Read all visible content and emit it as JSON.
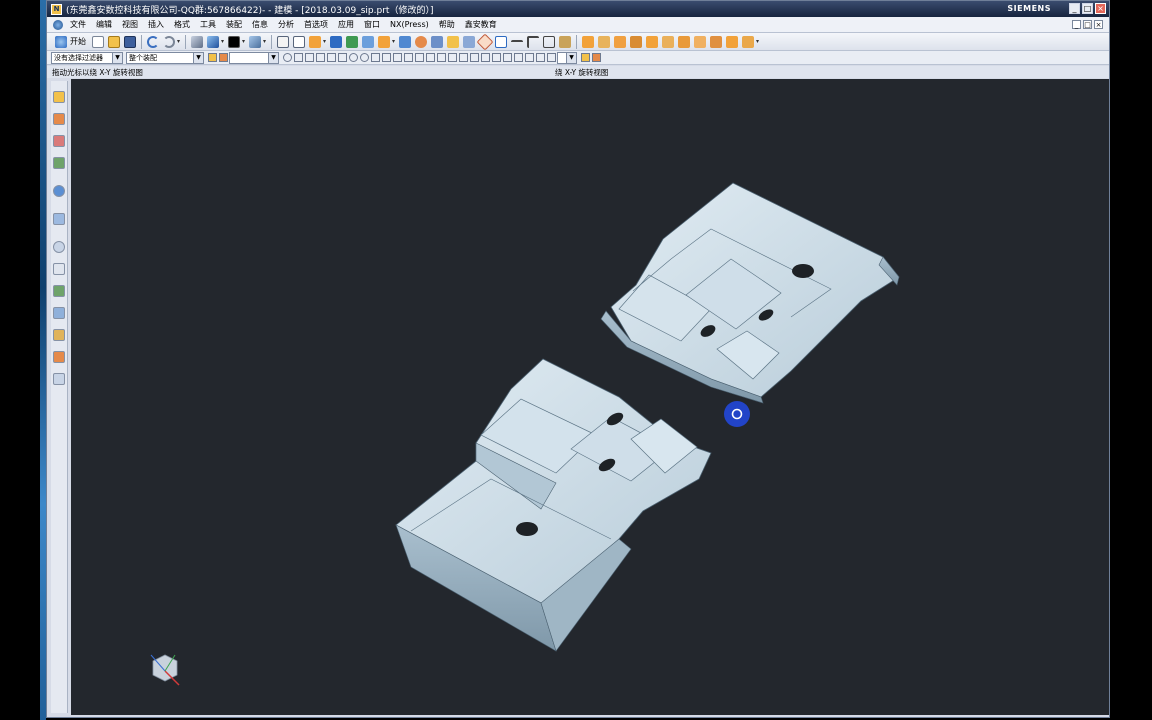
{
  "window": {
    "title": "(东莞鑫安数控科技有限公司-QQ群:567866422)- - 建模 - [2018.03.09_sip.prt（修改的）]",
    "brand": "SIEMENS",
    "controls": {
      "minimize": "_",
      "maximize": "□",
      "close": "×"
    }
  },
  "menu": {
    "items": [
      "文件",
      "编辑",
      "视图",
      "插入",
      "格式",
      "工具",
      "装配",
      "信息",
      "分析",
      "首选项",
      "应用",
      "窗口",
      "NX(Press)",
      "帮助",
      "鑫安教育"
    ]
  },
  "toolbar": {
    "start_label": "开始",
    "colors": {
      "accent": "#f2a23a",
      "blue": "#2e6bc2",
      "green": "#3f9a52"
    }
  },
  "selection_bar": {
    "filter": "没有选择过滤器",
    "scope": "整个装配",
    "extra": ""
  },
  "status": {
    "left": "拖动光标以绕 X-Y 旋转视图",
    "center": "绕 X-Y 旋转视图"
  },
  "viewport": {
    "background": "#23272d",
    "part_color": "#c8dbe6",
    "spinner_icon": "rotate-cursor-icon",
    "triad_icon": "view-triad-icon"
  }
}
